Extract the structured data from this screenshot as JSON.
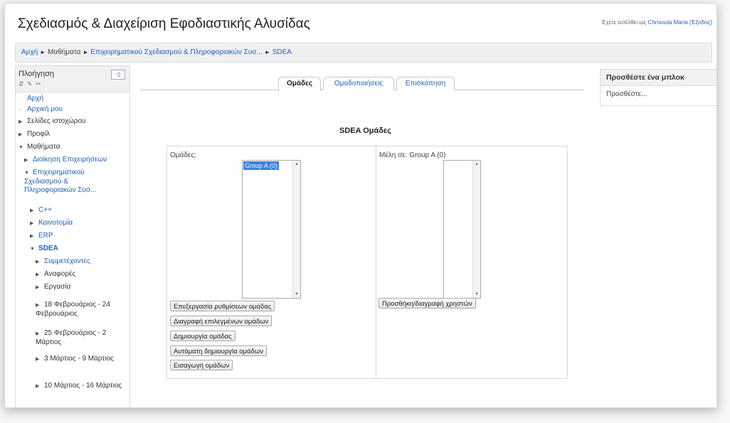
{
  "header": {
    "site_title": "Σχεδιασμός & Διαχείριση Εφοδιαστικής Αλυσίδας",
    "login_prefix": "Έχετε εισέλθει ως",
    "login_user": "Chrisoula Maria",
    "login_logout": "(Έξοδος)"
  },
  "breadcrumb": {
    "items": [
      "Αρχή",
      "Μαθήματα",
      "Επιχειρηματικού Σχεδιασμού & Πληροφοριακών Συσ...",
      "SDEA"
    ],
    "separator": "►"
  },
  "navigation_block": {
    "title": "Πλοήγηση",
    "icons": "⇵ ✎ ✂",
    "dock_icon": "dock-icon",
    "items": [
      {
        "label": "Αρχή",
        "arrow": ""
      },
      {
        "label": "Αρχική μου",
        "arrow": "◦"
      },
      {
        "label": "Σελίδες ιστοχώρου",
        "arrow": "▶"
      },
      {
        "label": "Προφίλ",
        "arrow": "▶"
      },
      {
        "label": "Μαθήματα",
        "arrow": "▼"
      },
      {
        "label": "Διοίκηση Επιχειρήσεων",
        "arrow": "▶"
      },
      {
        "label": "Επιχειρηματικού Σχεδιασμού & Πληροφοριακών Συσ...",
        "arrow": "▼"
      },
      {
        "label": "C++",
        "arrow": "▶"
      },
      {
        "label": "Καινοτομία",
        "arrow": "▶"
      },
      {
        "label": "ERP",
        "arrow": "▶"
      },
      {
        "label": "SDEA",
        "arrow": "▼"
      },
      {
        "label": "Συμμετέχοντες",
        "arrow": "▶"
      },
      {
        "label": "Αναφορές",
        "arrow": "▶"
      },
      {
        "label": "Εργασία",
        "arrow": "▶"
      },
      {
        "label": "18 Φεβρουάριος - 24 Φεβρουάριος",
        "arrow": "▶"
      },
      {
        "label": "25 Φεβρουάριος - 2 Μάρτιος",
        "arrow": "▶"
      },
      {
        "label": "3 Μάρτιος - 9 Μάρτιος",
        "arrow": "▶"
      },
      {
        "label": "10 Μάρτιος - 16 Μάρτιος",
        "arrow": "▶"
      }
    ]
  },
  "tabs": [
    {
      "label": "Ομάδες",
      "active": true
    },
    {
      "label": "Ομαδοποιήσεις",
      "active": false
    },
    {
      "label": "Επισκόπηση",
      "active": false
    }
  ],
  "main": {
    "heading": "SDEA Ομάδες",
    "groups_label": "Ομάδες:",
    "groups_options": [
      "Group A (0)"
    ],
    "members_label": "Μέλη σε: Group A (0)",
    "group_buttons": [
      "Επεξεργασία ρυθμίσεων ομάδας",
      "Διαγραφή επιλεγμένων ομάδων",
      "Δημιουργία ομάδας",
      "Αυτόματη δημιουργία ομάδων",
      "Εισαγωγή ομάδων"
    ],
    "members_button": "Προσθήκη/διαγραφή χρηστών"
  },
  "add_block": {
    "title": "Προσθέστε ένα μπλοκ",
    "select_value": "Προσθέστε..."
  },
  "colors": {
    "link": "#1f5fb8",
    "selected_option": "#3b7fe0"
  }
}
